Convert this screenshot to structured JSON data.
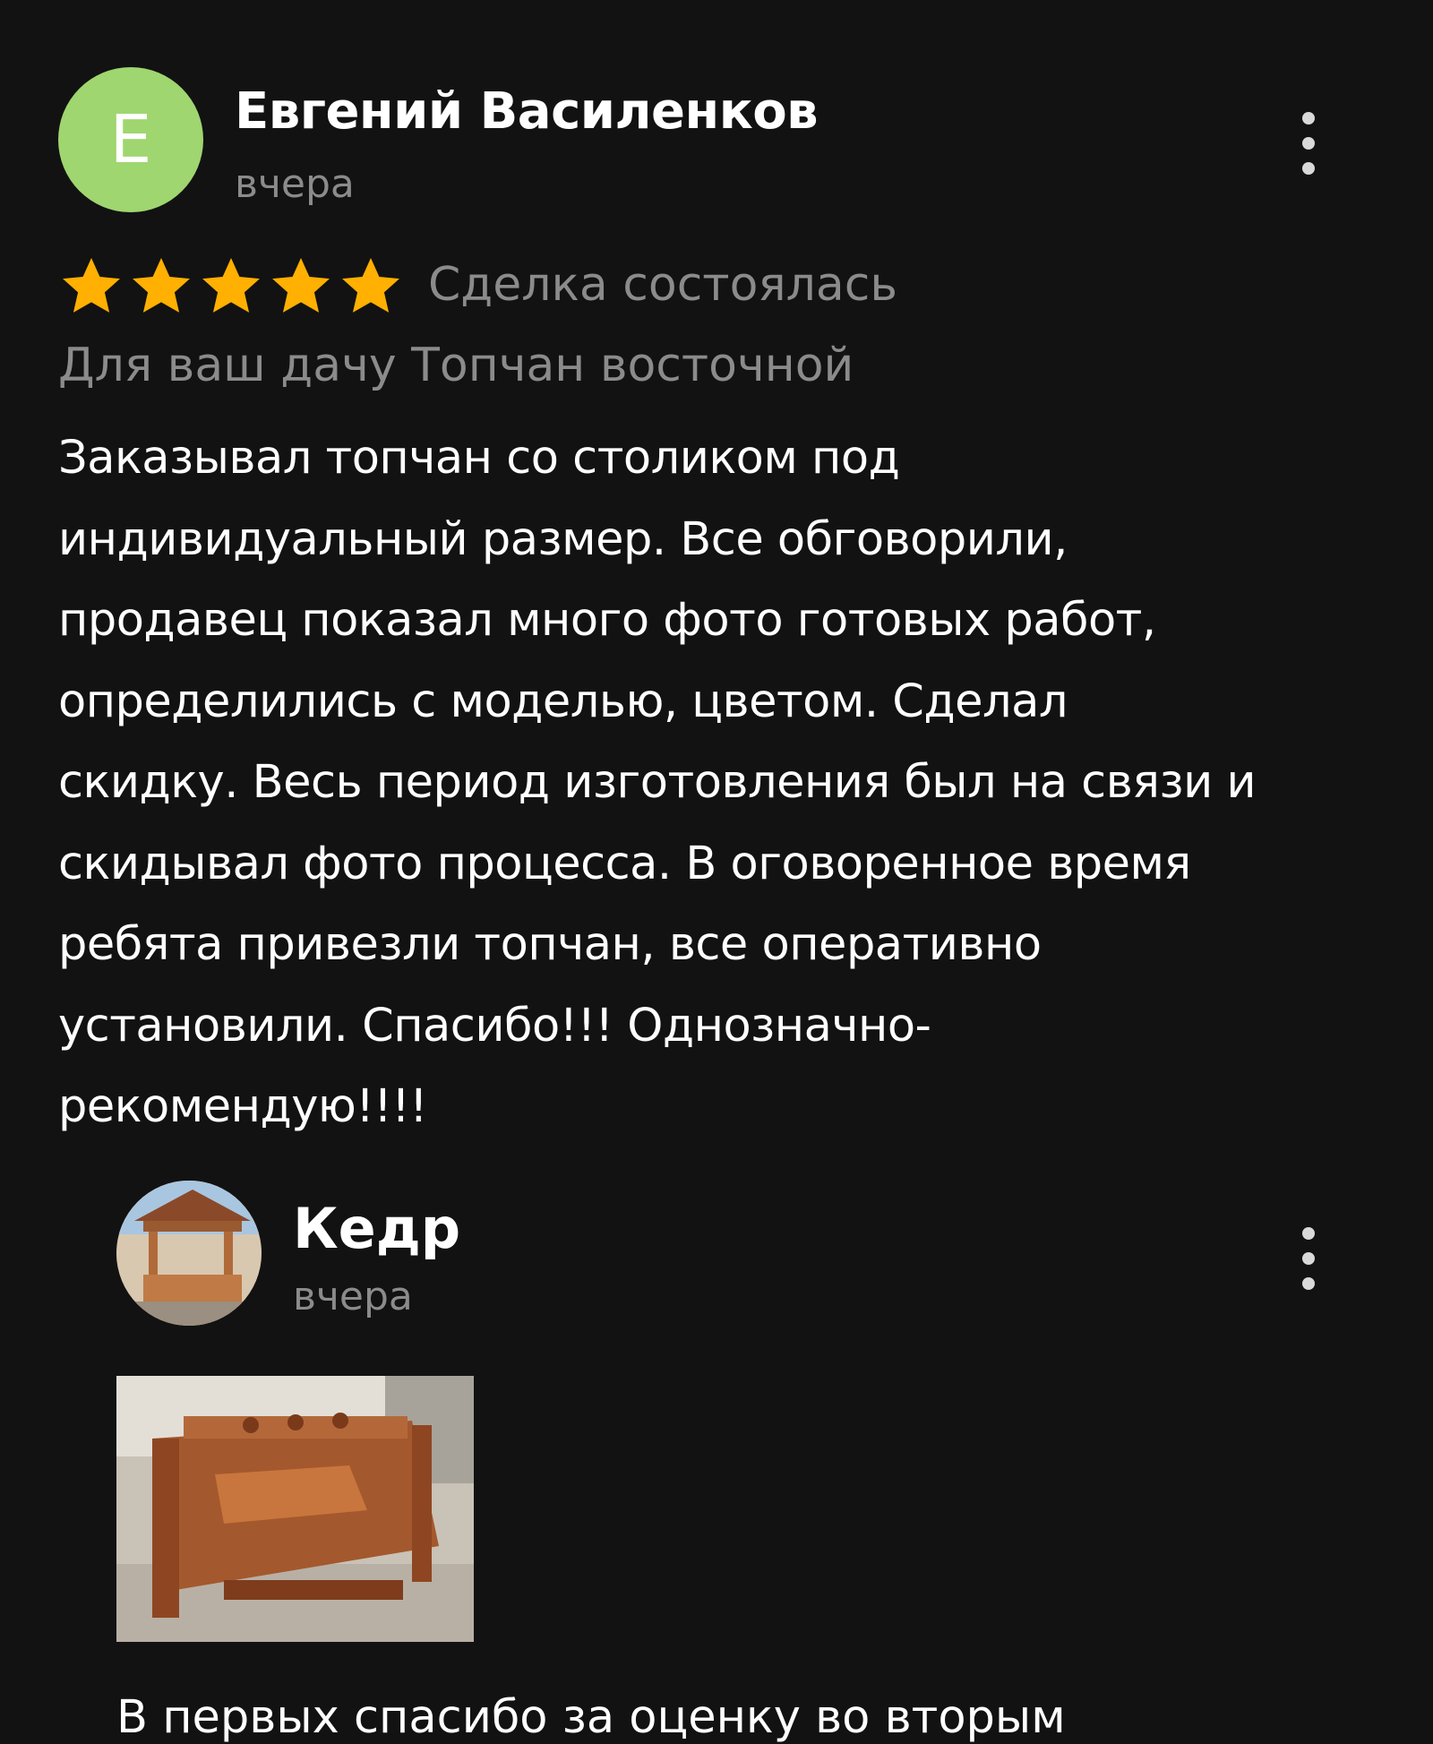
{
  "review": {
    "avatar_letter": "Е",
    "avatar_color": "#9fd66f",
    "author_name": "Евгений Василенков",
    "date": "вчера",
    "rating": 5,
    "star_color": "#ffb000",
    "deal_status": "Сделка состоялась",
    "item_title": "Для ваш дачу Топчан восточной",
    "text_lines": [
      "Заказывал топчан со столиком под",
      "индивидуальный размер. Все обговорили,",
      "продавец показал много фото готовых работ,",
      "определились с моделью, цветом. Сделал",
      "скидку. Весь период изготовления был на связи и",
      "скидывал фото процесса. В оговоренное время",
      "ребята привезли топчан, все оперативно",
      "установили. Спасибо!!! Однозначно-",
      "рекомендую!!!!"
    ]
  },
  "reply": {
    "seller_name": "Кедр",
    "date": "вчера",
    "text_partial": "В первых спасибо за оценку во вторым"
  },
  "icons": {
    "menu": "more-vert-icon",
    "star": "star-icon"
  }
}
